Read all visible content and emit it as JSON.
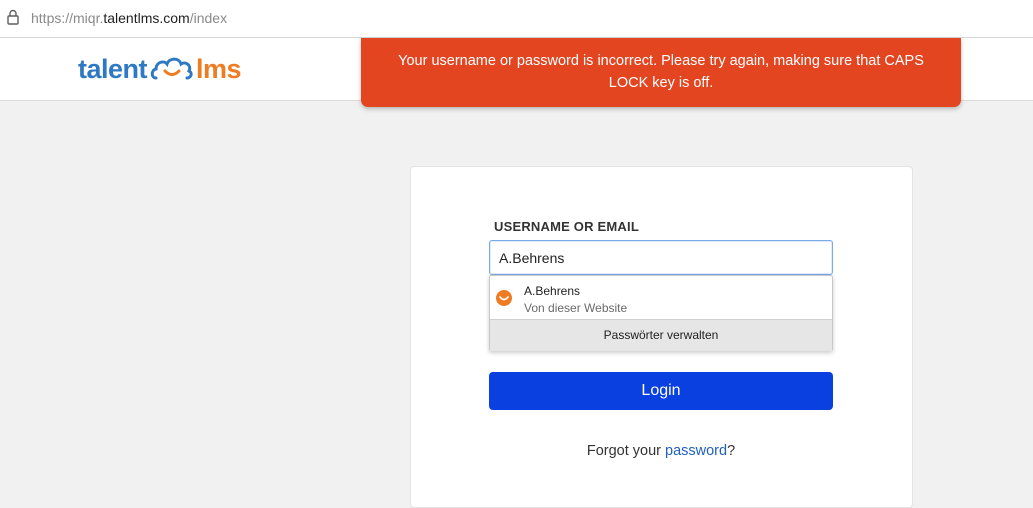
{
  "browser": {
    "url_prefix": "https://miqr.",
    "url_host": "talentlms.com",
    "url_path": "/index"
  },
  "header": {
    "logo_left": "talent",
    "logo_right": "lms"
  },
  "toast": {
    "message": "Your username or password is incorrect. Please try again, making sure that CAPS LOCK key is off.",
    "color": "#e34520"
  },
  "login": {
    "username_label": "USERNAME OR EMAIL",
    "username_value": "A.Behrens",
    "login_button": "Login",
    "forgot_prefix": "Forgot your ",
    "forgot_link": "password",
    "forgot_suffix": "?",
    "button_color": "#0a3fe0"
  },
  "autofill": {
    "entry_user": "A.Behrens",
    "entry_source": "Von dieser Website",
    "manage_label": "Passwörter verwalten"
  }
}
